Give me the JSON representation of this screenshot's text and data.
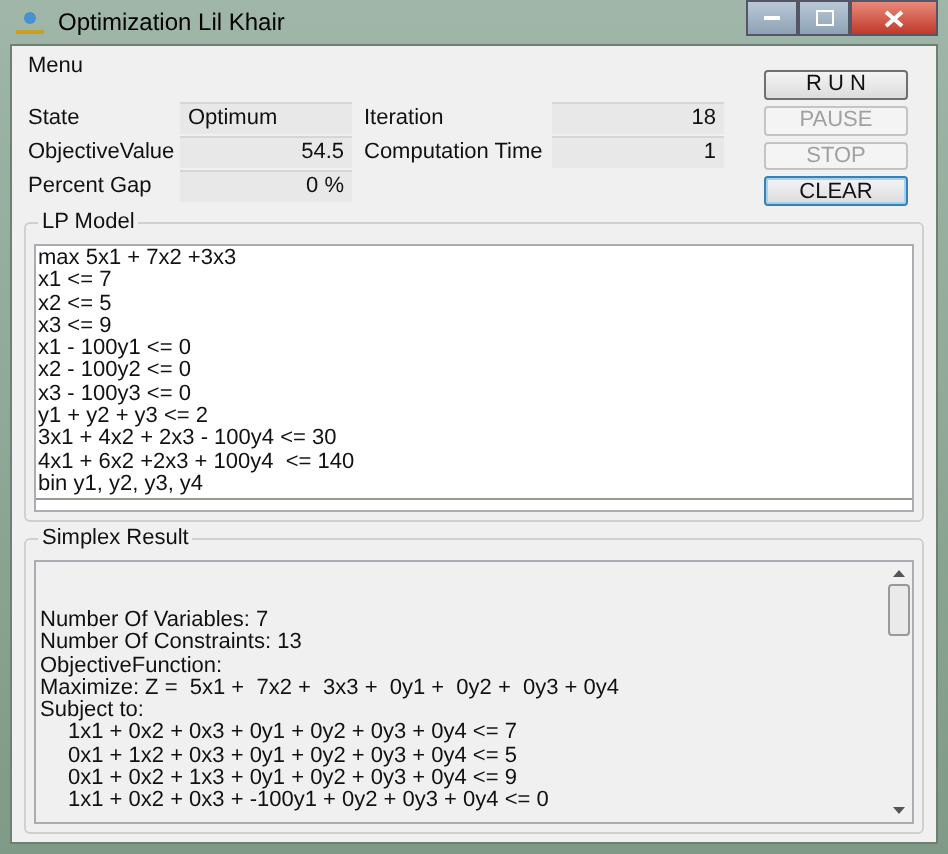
{
  "window": {
    "title": "Optimization Lil Khair"
  },
  "menu": {
    "label": "Menu"
  },
  "fields": [
    {
      "label": "State",
      "value": "Optimum"
    },
    {
      "label": "Iteration",
      "value": "18"
    },
    {
      "label": "ObjectiveValue",
      "value": "54.5"
    },
    {
      "label": "Computation Time",
      "value": "1"
    },
    {
      "label": "Percent Gap",
      "value": "0 %"
    }
  ],
  "buttons": [
    {
      "label": "R U N",
      "disabled": false,
      "focused": false
    },
    {
      "label": "PAUSE",
      "disabled": true,
      "focused": false
    },
    {
      "label": "STOP",
      "disabled": true,
      "focused": false
    },
    {
      "label": "CLEAR",
      "disabled": false,
      "focused": true
    }
  ],
  "lp_model": {
    "title": "LP Model",
    "lines": [
      "max 5x1 + 7x2 +3x3",
      "x1 <= 7",
      "x2 <= 5",
      "x3 <= 9",
      "x1 - 100y1 <= 0",
      "x2 - 100y2 <= 0",
      "x3 - 100y3 <= 0",
      "y1 + y2 + y3 <= 2",
      "3x1 + 4x2 + 2x3 - 100y4 <= 30",
      "4x1 + 6x2 +2x3 + 100y4  <= 140",
      "bin y1, y2, y3, y4"
    ]
  },
  "simplex_result": {
    "title": "Simplex Result",
    "lines": [
      "Number Of Variables: 7",
      "Number Of Constraints: 13",
      "ObjectiveFunction:",
      "Maximize: Z =  5x1 +  7x2 +  3x3 +  0y1 +  0y2 +  0y3 + 0y4",
      "Subject to:"
    ],
    "constraints": [
      "1x1 + 0x2 + 0x3 + 0y1 + 0y2 + 0y3 + 0y4 <= 7",
      "0x1 + 1x2 + 0x3 + 0y1 + 0y2 + 0y3 + 0y4 <= 5",
      "0x1 + 0x2 + 1x3 + 0y1 + 0y2 + 0y3 + 0y4 <= 9",
      "1x1 + 0x2 + 0x3 + -100y1 + 0y2 + 0y3 + 0y4 <= 0"
    ]
  }
}
